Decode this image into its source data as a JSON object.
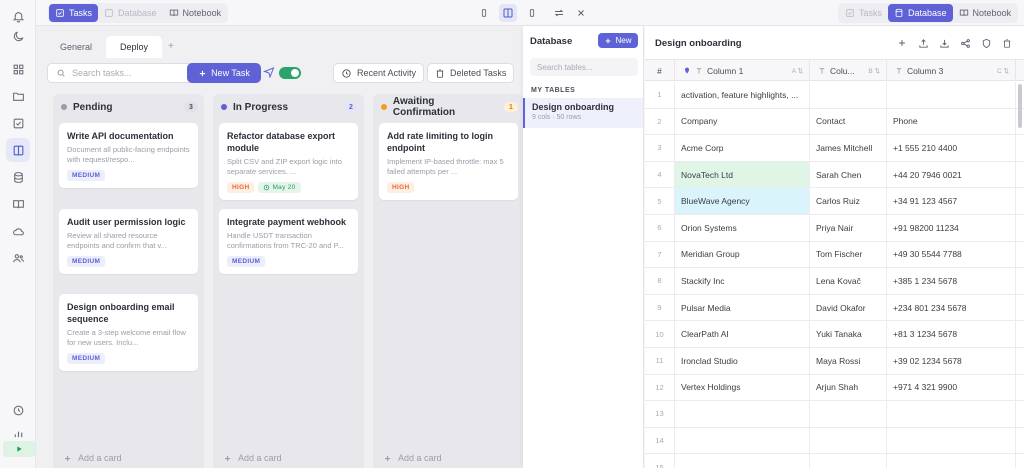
{
  "topbar": {
    "left_tabs": [
      {
        "label": "Tasks",
        "icon": "tasks-icon",
        "state": "active"
      },
      {
        "label": "Database",
        "icon": "database-icon",
        "state": "disabled"
      },
      {
        "label": "Notebook",
        "icon": "notebook-icon",
        "state": "normal"
      }
    ],
    "right_tabs": [
      {
        "label": "Tasks",
        "icon": "tasks-icon",
        "state": "disabled"
      },
      {
        "label": "Database",
        "icon": "database-icon",
        "state": "active"
      },
      {
        "label": "Notebook",
        "icon": "notebook-icon",
        "state": "normal"
      }
    ]
  },
  "tasks": {
    "tabs": [
      {
        "label": "General"
      },
      {
        "label": "Deploy"
      }
    ],
    "tab_add": "+",
    "search_placeholder": "Search tasks...",
    "new_task_label": "New Task",
    "recent_activity_label": "Recent Activity",
    "deleted_tasks_label": "Deleted Tasks",
    "add_card_label": "Add a card",
    "columns": [
      {
        "title": "Pending",
        "count": "3",
        "dot_color": "#9a9da8",
        "count_bg": "#e0e1e8",
        "count_fg": "#4a4d58",
        "cards": [
          {
            "title": "Write API documentation",
            "desc": "Document all public-facing endpoints with request/respo...",
            "badges": [
              {
                "label": "MEDIUM",
                "kind": "med"
              }
            ]
          },
          {
            "title": "Audit user permission logic",
            "desc": "Review all shared resource endpoints and confirm that v...",
            "badges": [
              {
                "label": "MEDIUM",
                "kind": "med"
              }
            ]
          },
          {
            "title": "Design onboarding email sequence",
            "desc": "Create a 3-step welcome email flow for new users. Inclu...",
            "badges": [
              {
                "label": "MEDIUM",
                "kind": "med"
              }
            ]
          }
        ]
      },
      {
        "title": "In Progress",
        "count": "2",
        "dot_color": "#5e62d6",
        "count_bg": "#e4e6f6",
        "count_fg": "#5e62d6",
        "cards": [
          {
            "title": "Refactor database export module",
            "desc": "Split CSV and ZIP export logic into separate services. ...",
            "badges": [
              {
                "label": "HIGH",
                "kind": "high"
              },
              {
                "label": "May 20",
                "kind": "date"
              }
            ]
          },
          {
            "title": "Integrate payment webhook",
            "desc": "Handle USDT transaction confirmations from TRC-20 and P...",
            "badges": [
              {
                "label": "MEDIUM",
                "kind": "med"
              }
            ]
          }
        ]
      },
      {
        "title": "Awaiting Confirmation",
        "count": "1",
        "dot_color": "#f0a020",
        "count_bg": "#fdf0d8",
        "count_fg": "#c9800b",
        "cards": [
          {
            "title": "Add rate limiting to login endpoint",
            "desc": "Implement IP-based throttle: max 5 failed attempts per ...",
            "badges": [
              {
                "label": "HIGH",
                "kind": "high"
              }
            ]
          }
        ]
      }
    ]
  },
  "database": {
    "title": "Database",
    "new_label": "New",
    "search_placeholder": "Search tables...",
    "section_label": "MY TABLES",
    "tables": [
      {
        "name": "Design onboarding",
        "meta": "9 cols · 50 rows"
      }
    ]
  },
  "grid": {
    "title": "Design onboarding",
    "index_header": "#",
    "columns": [
      {
        "label": "Column 1",
        "type": "A",
        "sort": "⇅"
      },
      {
        "label": "Colu...",
        "type": "B",
        "sort": "⇅"
      },
      {
        "label": "Column 3",
        "type": "C",
        "sort": "⇅"
      }
    ],
    "rows": [
      {
        "n": "1",
        "c": [
          "activation, feature highlights, ...",
          "",
          ""
        ]
      },
      {
        "n": "2",
        "c": [
          "Company",
          "Contact",
          "Phone"
        ]
      },
      {
        "n": "3",
        "c": [
          "Acme Corp",
          "James Mitchell",
          "+1 555 210 4400"
        ]
      },
      {
        "n": "4",
        "c": [
          "NovaTech Ltd",
          "Sarah Chen",
          "+44 20 7946 0021"
        ],
        "hl": "green"
      },
      {
        "n": "5",
        "c": [
          "BlueWave Agency",
          "Carlos Ruiz",
          "+34 91 123 4567"
        ],
        "hl": "blue"
      },
      {
        "n": "6",
        "c": [
          "Orion Systems",
          "Priya Nair",
          "+91 98200 11234"
        ]
      },
      {
        "n": "7",
        "c": [
          "Meridian Group",
          "Tom Fischer",
          "+49 30 5544 7788"
        ]
      },
      {
        "n": "8",
        "c": [
          "Stackify Inc",
          "Lena Kovač",
          "+385 1 234 5678"
        ]
      },
      {
        "n": "9",
        "c": [
          "Pulsar Media",
          "David Okafor",
          "+234 801 234 5678"
        ]
      },
      {
        "n": "10",
        "c": [
          "ClearPath AI",
          "Yuki Tanaka",
          "+81 3 1234 5678"
        ]
      },
      {
        "n": "11",
        "c": [
          "Ironclad Studio",
          "Maya Rossi",
          "+39 02 1234 5678"
        ]
      },
      {
        "n": "12",
        "c": [
          "Vertex Holdings",
          "Arjun Shah",
          "+971 4 321 9900"
        ]
      },
      {
        "n": "13",
        "c": [
          "",
          "",
          ""
        ]
      },
      {
        "n": "14",
        "c": [
          "",
          "",
          ""
        ]
      },
      {
        "n": "15",
        "c": [
          "",
          "",
          ""
        ]
      }
    ]
  }
}
